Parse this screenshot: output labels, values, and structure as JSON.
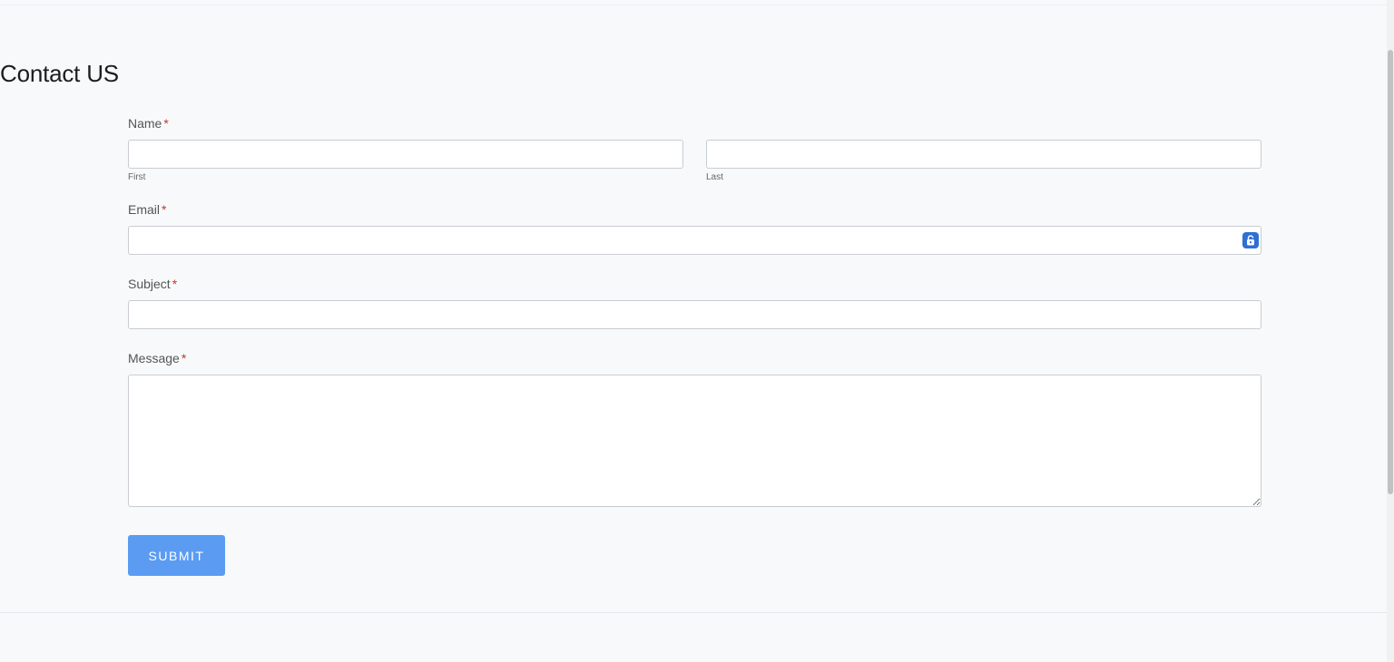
{
  "page": {
    "title": "Contact US"
  },
  "form": {
    "name": {
      "label": "Name",
      "required_mark": "*",
      "first_sublabel": "First",
      "last_sublabel": "Last",
      "first_value": "",
      "last_value": ""
    },
    "email": {
      "label": "Email",
      "required_mark": "*",
      "value": ""
    },
    "subject": {
      "label": "Subject",
      "required_mark": "*",
      "value": ""
    },
    "message": {
      "label": "Message",
      "required_mark": "*",
      "value": ""
    },
    "submit_label": "SUBMIT"
  },
  "icons": {
    "password_manager": "password-manager-icon"
  },
  "colors": {
    "accent": "#5b9cf2",
    "required": "#c0392b",
    "password_icon": "#2f6fd3"
  }
}
